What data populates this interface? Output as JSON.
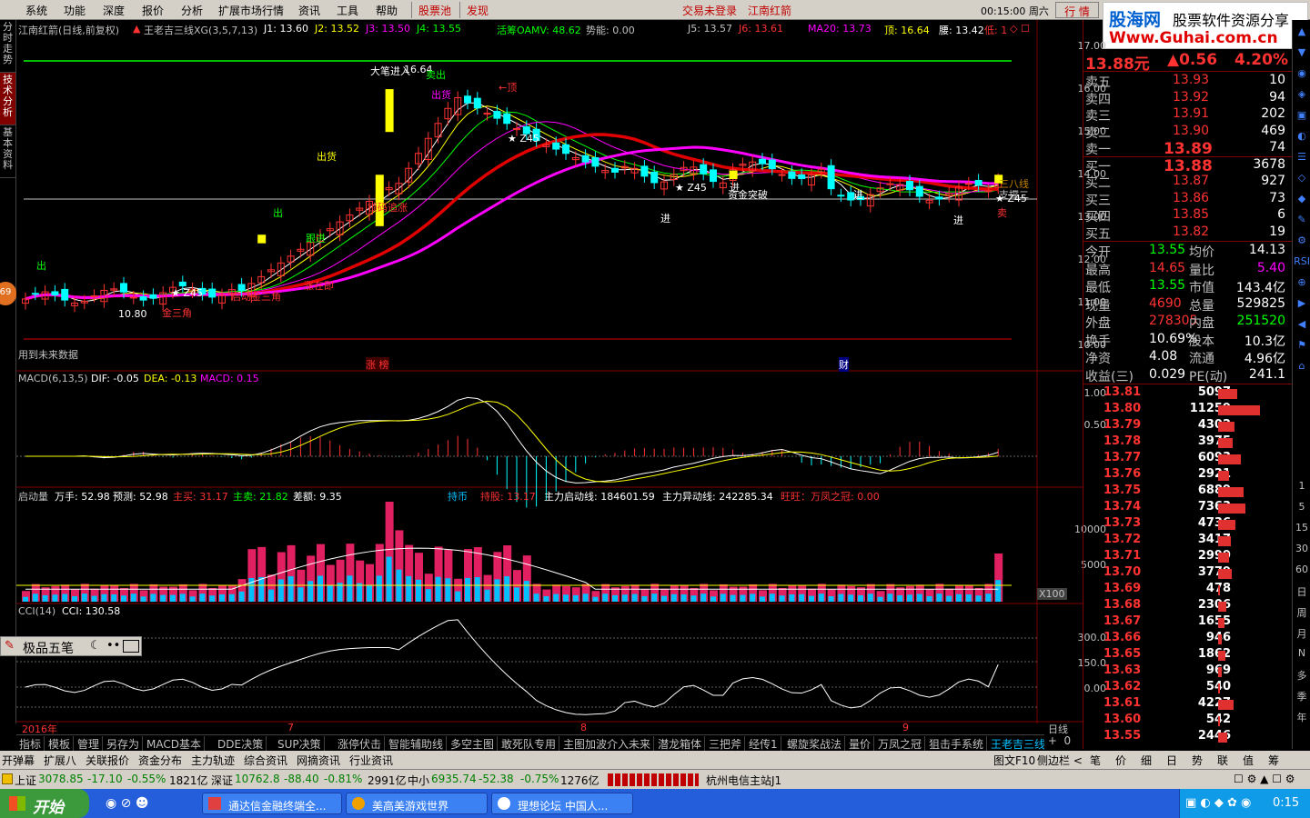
{
  "menu": {
    "items": [
      "系统",
      "功能",
      "深度",
      "报价",
      "分析",
      "扩展市场行情",
      "资讯",
      "工具",
      "帮助"
    ],
    "red_items": [
      "股票池",
      "发现"
    ],
    "login": "交易未登录",
    "stock": "江南红箭",
    "time": "00:15:00 周六",
    "quote_btn": "行 情"
  },
  "logo": {
    "text1": "股海网",
    "text2": "股票软件资源分享",
    "url": "Www.Guhai.com.cn"
  },
  "left_tabs": [
    "分时走势",
    "技术分析",
    "基本资料"
  ],
  "main_chart": {
    "title": "江南红箭(日线,前复权)",
    "indicator": "王老吉三线XG(3,5,7,13)",
    "j1": "J1: 13.60",
    "j2": "J2: 13.52",
    "j3": "J3: 13.50",
    "j4": "J4: 13.55",
    "oamv": "活筹OAMV: 48.62",
    "power": "势能: 0.00",
    "j5": "J5: 13.57",
    "j6": "J6: 13.61",
    "ma20": "MA20: 13.73",
    "top": "顶: 16.64",
    "waist": "腰: 13.42",
    "low": "低: 1",
    "future": "用到未来数据",
    "yticks": [
      "17.00",
      "16.00",
      "15.00",
      "14.00",
      "13.00",
      "12.00",
      "11.00",
      "10.00"
    ],
    "annotations": [
      "大笔进入",
      "16.64",
      "卖出",
      "出货",
      "←顶",
      "出货",
      "出",
      "跟进",
      "锁码追涨",
      "涨在即",
      "启动金三角",
      "10.80",
      "金三角",
      "出",
      "★ Z45",
      "进",
      "★ Z45",
      "★ Z45",
      "资金突破",
      "进",
      "进",
      "进",
      "三八线",
      "支撑二",
      "★ Z45",
      "卖",
      "涨 榜",
      "财"
    ]
  },
  "macd": {
    "title": "MACD(6,13,5)",
    "dif": "DIF: -0.05",
    "dea": "DEA: -0.13",
    "macd": "MACD: 0.15",
    "yticks": [
      "1.00",
      "0.50"
    ]
  },
  "volume": {
    "title": "启动量",
    "wanshou": "万手: 52.98",
    "forecast": "预测: 52.98",
    "mainbuy": "主买: 31.17",
    "mainsell": "主卖: 21.82",
    "diff": "差额: 9.35",
    "holders": "持币",
    "holding": "持股: 13.17",
    "start_line": "主力启动线: 184601.59",
    "abn_line": "主力异动线: 242285.34",
    "wangwang": "旺旺：万凤之冠: 0.00",
    "yticks": [
      "10000",
      "5000"
    ],
    "unit": "X100"
  },
  "cci": {
    "title": "CCI(14)",
    "value": "CCI: 130.58",
    "yticks": [
      "300.0",
      "150.0",
      "0.00"
    ],
    "box": "极品五笔"
  },
  "x_axis": {
    "labels": [
      "2016年",
      "7",
      "8",
      "9"
    ],
    "period": "日线"
  },
  "quote": {
    "price": "13.88元",
    "change": "▲0.56",
    "pct": "4.20%",
    "sells": [
      {
        "label": "卖五",
        "price": "13.93",
        "vol": "10"
      },
      {
        "label": "卖四",
        "price": "13.92",
        "vol": "94"
      },
      {
        "label": "卖三",
        "price": "13.91",
        "vol": "202"
      },
      {
        "label": "卖二",
        "price": "13.90",
        "vol": "469"
      },
      {
        "label": "卖一",
        "price": "13.89",
        "vol": "74"
      }
    ],
    "buys": [
      {
        "label": "买一",
        "price": "13.88",
        "vol": "3678"
      },
      {
        "label": "买二",
        "price": "13.87",
        "vol": "927"
      },
      {
        "label": "买三",
        "price": "13.86",
        "vol": "73"
      },
      {
        "label": "买四",
        "price": "13.85",
        "vol": "6"
      },
      {
        "label": "买五",
        "price": "13.82",
        "vol": "19"
      }
    ],
    "stats": [
      {
        "l1": "今开",
        "v1": "13.55",
        "l2": "均价",
        "v2": "14.13"
      },
      {
        "l1": "最高",
        "v1": "14.65",
        "l2": "量比",
        "v2": "5.40"
      },
      {
        "l1": "最低",
        "v1": "13.55",
        "l2": "市值",
        "v2": "143.4亿"
      },
      {
        "l1": "现量",
        "v1": "4690",
        "l2": "总量",
        "v2": "529825"
      },
      {
        "l1": "外盘",
        "v1": "278305",
        "l2": "内盘",
        "v2": "251520"
      },
      {
        "l1": "换手",
        "v1": "10.69%",
        "l2": "股本",
        "v2": "10.3亿"
      },
      {
        "l1": "净资",
        "v1": "4.08",
        "l2": "流通",
        "v2": "4.96亿"
      },
      {
        "l1": "收益(三)",
        "v1": "0.029",
        "l2": "PE(动)",
        "v2": "241.1"
      }
    ]
  },
  "ticks": [
    {
      "p": "13.81",
      "v": "5097"
    },
    {
      "p": "13.80",
      "v": "11259"
    },
    {
      "p": "13.79",
      "v": "4302"
    },
    {
      "p": "13.78",
      "v": "3975"
    },
    {
      "p": "13.77",
      "v": "6093"
    },
    {
      "p": "13.76",
      "v": "2921"
    },
    {
      "p": "13.75",
      "v": "6889"
    },
    {
      "p": "13.74",
      "v": "7363"
    },
    {
      "p": "13.73",
      "v": "4736"
    },
    {
      "p": "13.72",
      "v": "3417"
    },
    {
      "p": "13.71",
      "v": "2999"
    },
    {
      "p": "13.70",
      "v": "3779"
    },
    {
      "p": "13.69",
      "v": "478"
    },
    {
      "p": "13.68",
      "v": "2306"
    },
    {
      "p": "13.67",
      "v": "1655"
    },
    {
      "p": "13.66",
      "v": "946"
    },
    {
      "p": "13.65",
      "v": "1862"
    },
    {
      "p": "13.63",
      "v": "969"
    },
    {
      "p": "13.62",
      "v": "540"
    },
    {
      "p": "13.61",
      "v": "4227"
    },
    {
      "p": "13.60",
      "v": "542"
    },
    {
      "p": "13.55",
      "v": "2446"
    }
  ],
  "right_strip": [
    "1",
    "5",
    "15",
    "30",
    "60",
    "日",
    "周",
    "月",
    "N",
    "多",
    "季",
    "年"
  ],
  "bottom_tabs": [
    "指标",
    "模板",
    "管理",
    "另存为",
    "MACD基本",
    "DDE决策",
    "SUP决策",
    "涨停伏击",
    "智能辅助线",
    "多空主图",
    "敢死队专用",
    "主图加波介入未来",
    "潜龙箱体",
    "三把斧",
    "经传1",
    "螺旋桨战法",
    "量价",
    "万凤之冠",
    "狙击手系统",
    "王老吉三线XG"
  ],
  "bottom_tabs2": [
    "开弹幕",
    "扩展八",
    "关联报价",
    "资金分布",
    "主力轨迹",
    "综合资讯",
    "网摘资讯",
    "行业资讯"
  ],
  "bottom_right": {
    "f10": "图文F10",
    "side": "侧边栏 <",
    "tabs": [
      "笔",
      "价",
      "细",
      "日",
      "势",
      "联",
      "值",
      "筹"
    ]
  },
  "status": {
    "sh": "上证",
    "sh_v": "3078.85",
    "sh_c": "-17.10",
    "sh_p": "-0.55%",
    "sh_a": "1821亿",
    "sz": "深证",
    "sz_v": "10762.8",
    "sz_c": "-88.40",
    "sz_p": "-0.81%",
    "sz_a": "2991亿",
    "zx": "中小",
    "zx_v": "6935.74",
    "zx_c": "-52.38",
    "zx_p": "-0.75%",
    "zx_a": "1276亿",
    "server": "杭州电信主站J1"
  },
  "taskbar": {
    "start": "开始",
    "windows": [
      "通达信金融终端全...",
      "美高美游戏世界",
      "理想论坛 中国人..."
    ],
    "clock": "0:15"
  },
  "colors": {
    "up": "#ff3232",
    "down": "#00ffff",
    "yellow": "#ffff00",
    "magenta": "#ff00ff",
    "green": "#00c000",
    "red": "#e00000"
  }
}
